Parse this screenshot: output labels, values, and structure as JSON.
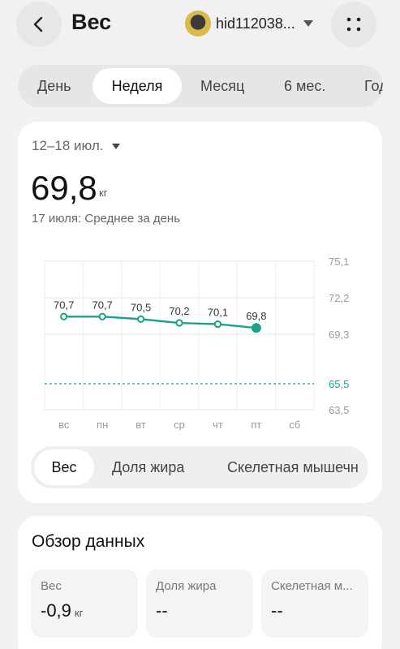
{
  "header": {
    "title": "Вес",
    "username": "hid112038...",
    "back_icon": "chevron-left-icon",
    "more_icon": "four-dots-icon"
  },
  "period_tabs": [
    "День",
    "Неделя",
    "Месяц",
    "6 мес.",
    "Год"
  ],
  "period_active": "Неделя",
  "summary": {
    "range": "12–18 июл.",
    "value": "69,8",
    "unit": "кг",
    "caption": "17 июля: Среднее за день"
  },
  "chart_data": {
    "type": "line",
    "categories": [
      "вс",
      "пн",
      "вт",
      "ср",
      "чт",
      "пт",
      "сб"
    ],
    "series": [
      {
        "values": [
          70.7,
          70.7,
          70.5,
          70.2,
          70.1,
          69.8,
          null
        ]
      }
    ],
    "value_labels": [
      "70,7",
      "70,7",
      "70,5",
      "70,2",
      "70,1",
      "69,8"
    ],
    "y_ticks": [
      "75,1",
      "72,2",
      "69,3",
      "65,5",
      "63,5"
    ],
    "y_tick_values": [
      75.1,
      72.2,
      69.3,
      65.5,
      63.5
    ],
    "target_line": {
      "value": 65.5,
      "label": "65,5"
    },
    "selected_index": 5,
    "ylim": [
      63.5,
      75.1
    ],
    "accent_color": "#1aa389",
    "grid": true
  },
  "metric_tabs": [
    "Вес",
    "Доля жира",
    "Скелетная мышечн"
  ],
  "metric_active": "Вес",
  "overview": {
    "title": "Обзор данных",
    "tiles": [
      {
        "label": "Вес",
        "value": "-0,9",
        "unit": "кг"
      },
      {
        "label": "Доля жира",
        "value": "--",
        "unit": ""
      },
      {
        "label": "Скелетная м...",
        "value": "--",
        "unit": ""
      }
    ]
  }
}
